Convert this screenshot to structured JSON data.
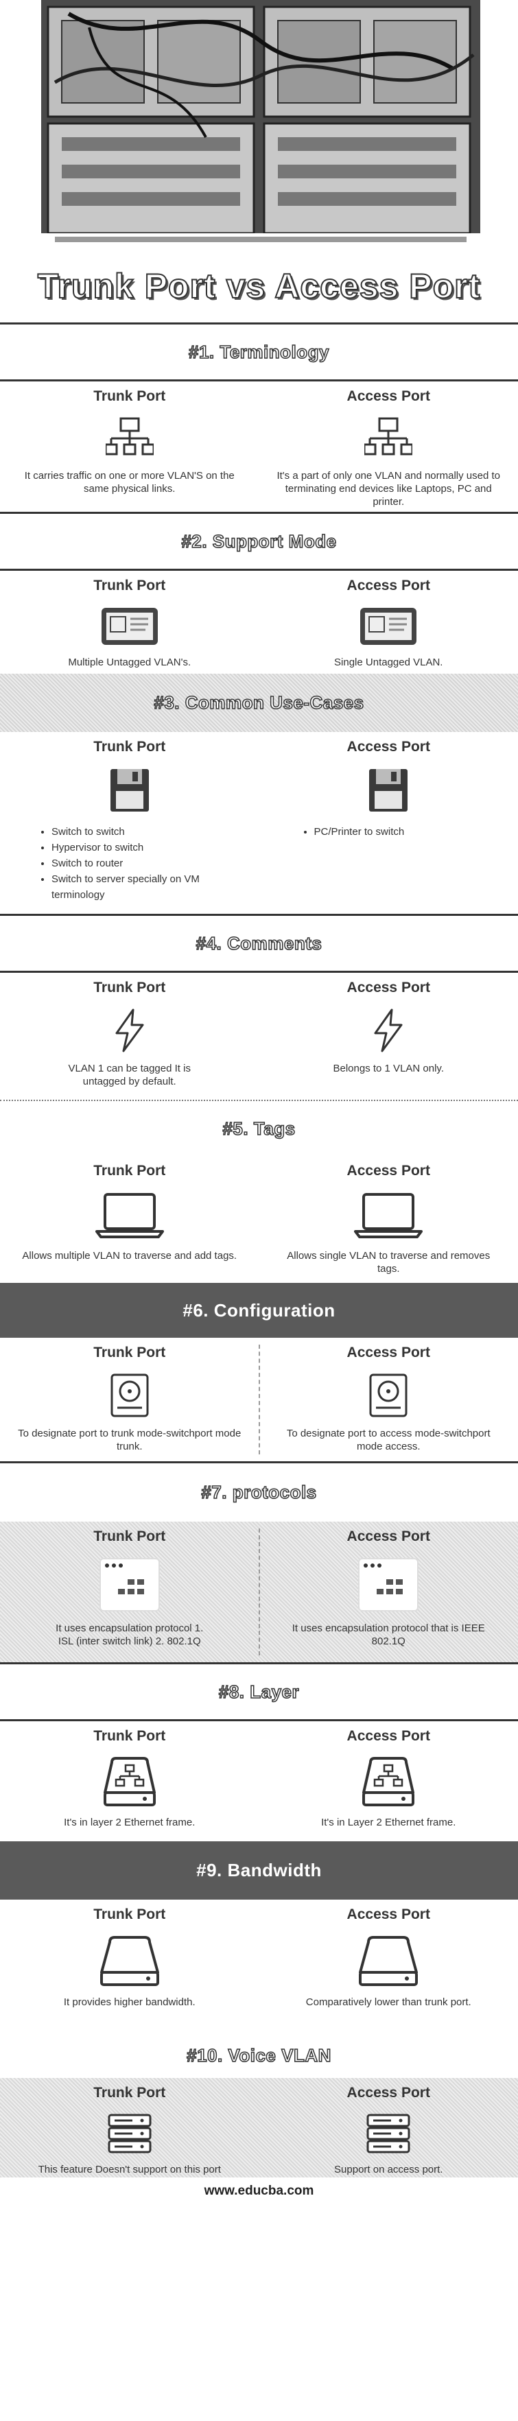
{
  "title": "Trunk Port vs Access Port",
  "labels": {
    "left": "Trunk Port",
    "right": "Access Port"
  },
  "sections": [
    {
      "heading": "#1. Terminology",
      "left": "It carries traffic on one or more VLAN'S on the same physical links.",
      "right": "It's a part of only one VLAN and normally used to terminating end devices like Laptops, PC and printer.",
      "icon": "network-tree-icon"
    },
    {
      "heading": "#2. Support Mode",
      "left": "Multiple Untagged VLAN's.",
      "right": "Single Untagged VLAN.",
      "icon": "tablet-icon"
    },
    {
      "heading": "#3. Common Use-Cases",
      "left_items": [
        "Switch to switch",
        "Hypervisor to switch",
        "Switch to router",
        "Switch to server specially on VM terminology"
      ],
      "right_items": [
        "PC/Printer to switch"
      ],
      "icon": "floppy-icon"
    },
    {
      "heading": "#4. Comments",
      "left": "VLAN 1 can be tagged It is untagged by default.",
      "right": "Belongs to 1 VLAN only.",
      "icon": "lightning-icon"
    },
    {
      "heading": "#5. Tags",
      "left": "Allows multiple VLAN to traverse and add tags.",
      "right": "Allows single VLAN to traverse and removes tags.",
      "icon": "laptop-icon"
    },
    {
      "heading": "#6. Configuration",
      "left": "To designate port to trunk mode-switchport mode trunk.",
      "right": "To designate port to access mode-switchport mode access.",
      "icon": "harddisk-icon"
    },
    {
      "heading": "#7. protocols",
      "left": "It uses encapsulation protocol 1. ISL (inter switch link) 2. 802.1Q",
      "right": "It uses encapsulation protocol that is IEEE 802.1Q",
      "icon": "app-window-icon"
    },
    {
      "heading": "#8. Layer",
      "left": "It's in layer 2 Ethernet frame.",
      "right": "It's in Layer 2 Ethernet frame.",
      "icon": "network-drive-icon"
    },
    {
      "heading": "#9. Bandwidth",
      "left": "It provides higher bandwidth.",
      "right": "Comparatively lower than trunk port.",
      "icon": "external-drive-icon"
    },
    {
      "heading": "#10. Voice VLAN",
      "left": "This feature Doesn't support on this port",
      "right": "Support on access port.",
      "icon": "server-stack-icon"
    }
  ],
  "footer": "www.educba.com"
}
